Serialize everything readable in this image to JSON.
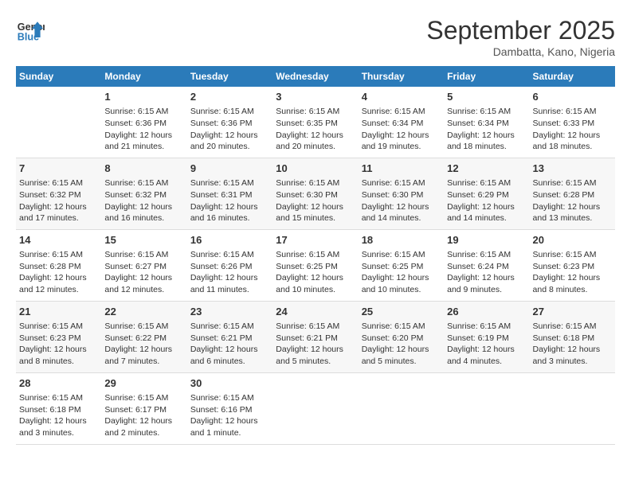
{
  "logo": {
    "line1": "General",
    "line2": "Blue"
  },
  "title": "September 2025",
  "location": "Dambatta, Kano, Nigeria",
  "days_of_week": [
    "Sunday",
    "Monday",
    "Tuesday",
    "Wednesday",
    "Thursday",
    "Friday",
    "Saturday"
  ],
  "weeks": [
    [
      {
        "day": "",
        "info": ""
      },
      {
        "day": "1",
        "info": "Sunrise: 6:15 AM\nSunset: 6:36 PM\nDaylight: 12 hours\nand 21 minutes."
      },
      {
        "day": "2",
        "info": "Sunrise: 6:15 AM\nSunset: 6:36 PM\nDaylight: 12 hours\nand 20 minutes."
      },
      {
        "day": "3",
        "info": "Sunrise: 6:15 AM\nSunset: 6:35 PM\nDaylight: 12 hours\nand 20 minutes."
      },
      {
        "day": "4",
        "info": "Sunrise: 6:15 AM\nSunset: 6:34 PM\nDaylight: 12 hours\nand 19 minutes."
      },
      {
        "day": "5",
        "info": "Sunrise: 6:15 AM\nSunset: 6:34 PM\nDaylight: 12 hours\nand 18 minutes."
      },
      {
        "day": "6",
        "info": "Sunrise: 6:15 AM\nSunset: 6:33 PM\nDaylight: 12 hours\nand 18 minutes."
      }
    ],
    [
      {
        "day": "7",
        "info": "Sunrise: 6:15 AM\nSunset: 6:32 PM\nDaylight: 12 hours\nand 17 minutes."
      },
      {
        "day": "8",
        "info": "Sunrise: 6:15 AM\nSunset: 6:32 PM\nDaylight: 12 hours\nand 16 minutes."
      },
      {
        "day": "9",
        "info": "Sunrise: 6:15 AM\nSunset: 6:31 PM\nDaylight: 12 hours\nand 16 minutes."
      },
      {
        "day": "10",
        "info": "Sunrise: 6:15 AM\nSunset: 6:30 PM\nDaylight: 12 hours\nand 15 minutes."
      },
      {
        "day": "11",
        "info": "Sunrise: 6:15 AM\nSunset: 6:30 PM\nDaylight: 12 hours\nand 14 minutes."
      },
      {
        "day": "12",
        "info": "Sunrise: 6:15 AM\nSunset: 6:29 PM\nDaylight: 12 hours\nand 14 minutes."
      },
      {
        "day": "13",
        "info": "Sunrise: 6:15 AM\nSunset: 6:28 PM\nDaylight: 12 hours\nand 13 minutes."
      }
    ],
    [
      {
        "day": "14",
        "info": "Sunrise: 6:15 AM\nSunset: 6:28 PM\nDaylight: 12 hours\nand 12 minutes."
      },
      {
        "day": "15",
        "info": "Sunrise: 6:15 AM\nSunset: 6:27 PM\nDaylight: 12 hours\nand 12 minutes."
      },
      {
        "day": "16",
        "info": "Sunrise: 6:15 AM\nSunset: 6:26 PM\nDaylight: 12 hours\nand 11 minutes."
      },
      {
        "day": "17",
        "info": "Sunrise: 6:15 AM\nSunset: 6:25 PM\nDaylight: 12 hours\nand 10 minutes."
      },
      {
        "day": "18",
        "info": "Sunrise: 6:15 AM\nSunset: 6:25 PM\nDaylight: 12 hours\nand 10 minutes."
      },
      {
        "day": "19",
        "info": "Sunrise: 6:15 AM\nSunset: 6:24 PM\nDaylight: 12 hours\nand 9 minutes."
      },
      {
        "day": "20",
        "info": "Sunrise: 6:15 AM\nSunset: 6:23 PM\nDaylight: 12 hours\nand 8 minutes."
      }
    ],
    [
      {
        "day": "21",
        "info": "Sunrise: 6:15 AM\nSunset: 6:23 PM\nDaylight: 12 hours\nand 8 minutes."
      },
      {
        "day": "22",
        "info": "Sunrise: 6:15 AM\nSunset: 6:22 PM\nDaylight: 12 hours\nand 7 minutes."
      },
      {
        "day": "23",
        "info": "Sunrise: 6:15 AM\nSunset: 6:21 PM\nDaylight: 12 hours\nand 6 minutes."
      },
      {
        "day": "24",
        "info": "Sunrise: 6:15 AM\nSunset: 6:21 PM\nDaylight: 12 hours\nand 5 minutes."
      },
      {
        "day": "25",
        "info": "Sunrise: 6:15 AM\nSunset: 6:20 PM\nDaylight: 12 hours\nand 5 minutes."
      },
      {
        "day": "26",
        "info": "Sunrise: 6:15 AM\nSunset: 6:19 PM\nDaylight: 12 hours\nand 4 minutes."
      },
      {
        "day": "27",
        "info": "Sunrise: 6:15 AM\nSunset: 6:18 PM\nDaylight: 12 hours\nand 3 minutes."
      }
    ],
    [
      {
        "day": "28",
        "info": "Sunrise: 6:15 AM\nSunset: 6:18 PM\nDaylight: 12 hours\nand 3 minutes."
      },
      {
        "day": "29",
        "info": "Sunrise: 6:15 AM\nSunset: 6:17 PM\nDaylight: 12 hours\nand 2 minutes."
      },
      {
        "day": "30",
        "info": "Sunrise: 6:15 AM\nSunset: 6:16 PM\nDaylight: 12 hours\nand 1 minute."
      },
      {
        "day": "",
        "info": ""
      },
      {
        "day": "",
        "info": ""
      },
      {
        "day": "",
        "info": ""
      },
      {
        "day": "",
        "info": ""
      }
    ]
  ]
}
